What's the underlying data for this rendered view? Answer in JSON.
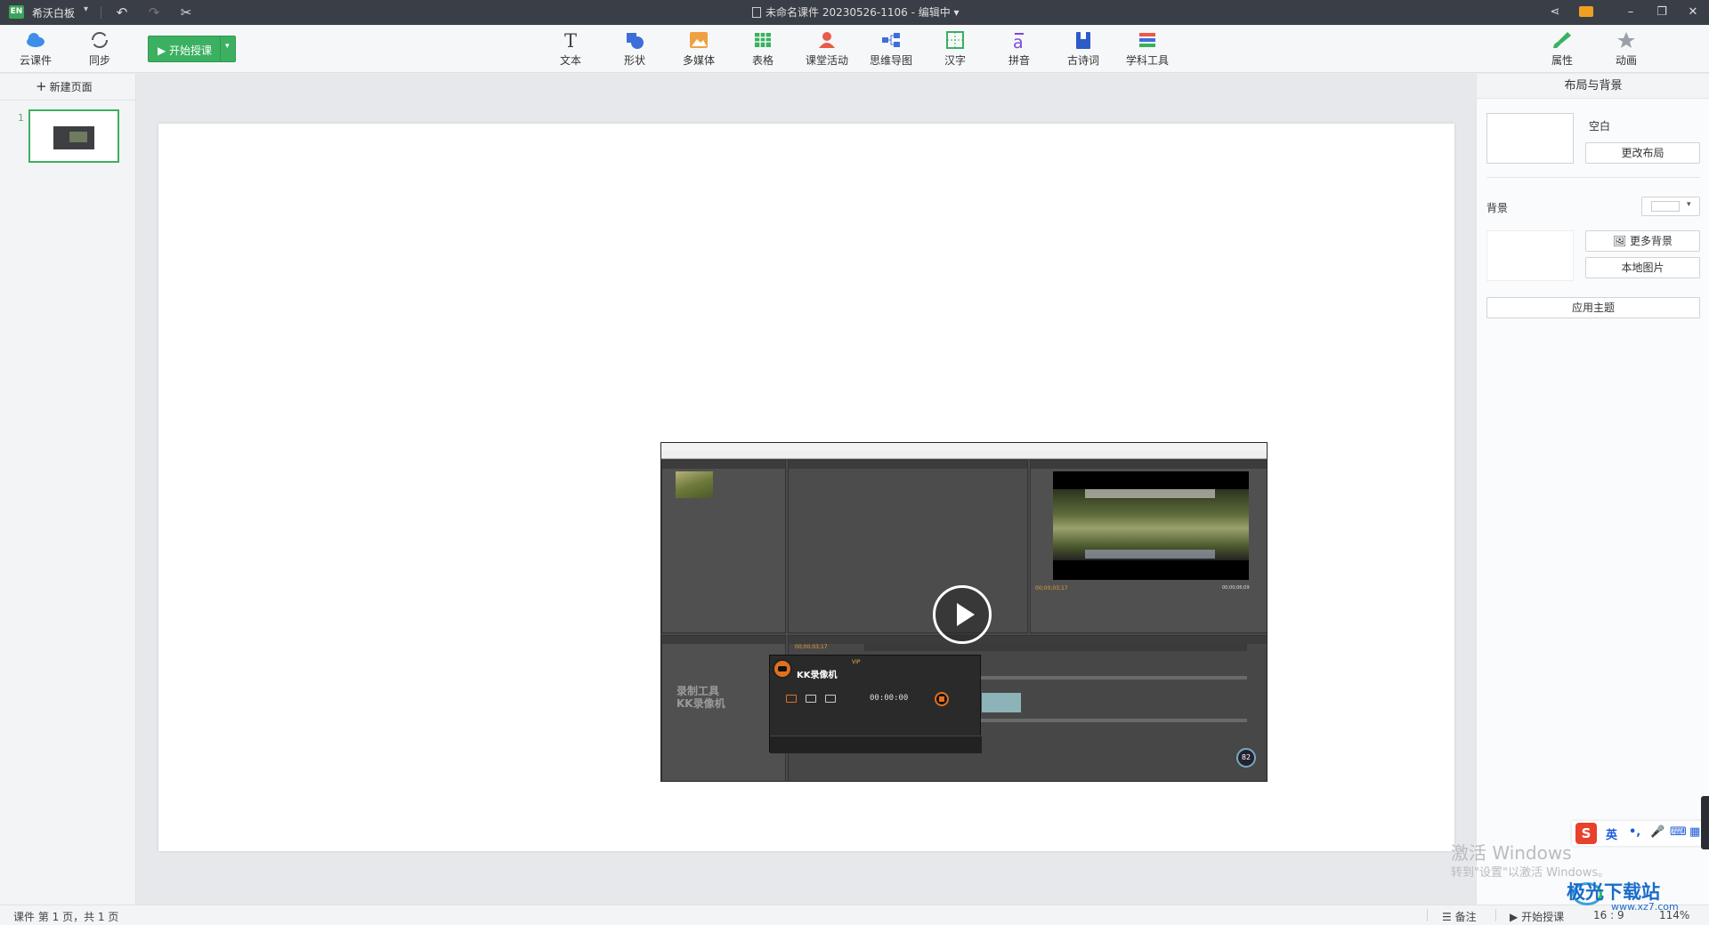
{
  "titlebar": {
    "logo": "EN",
    "app_name": "希沃白板",
    "doc_title": "未命名课件 20230526-1106 - 编辑中",
    "icons": [
      "undo-icon",
      "redo-icon",
      "scissors-icon",
      "share-icon",
      "mail-icon",
      "minimize-icon",
      "restore-icon",
      "close-icon"
    ]
  },
  "toolbar": {
    "cloud_label": "云课件",
    "sync_label": "同步",
    "start_label": "开始授课",
    "tools": [
      {
        "label": "文本",
        "icon": "text-icon"
      },
      {
        "label": "形状",
        "icon": "shape-icon"
      },
      {
        "label": "多媒体",
        "icon": "image-icon"
      },
      {
        "label": "表格",
        "icon": "table-icon"
      },
      {
        "label": "课堂活动",
        "icon": "activity-icon"
      },
      {
        "label": "思维导图",
        "icon": "mindmap-icon"
      },
      {
        "label": "汉字",
        "icon": "hanzi-icon"
      },
      {
        "label": "拼音",
        "icon": "pinyin-icon"
      },
      {
        "label": "古诗词",
        "icon": "poem-icon"
      },
      {
        "label": "学科工具",
        "icon": "subject-tools-icon"
      }
    ],
    "right_tabs": [
      {
        "label": "属性",
        "icon": "brush-icon"
      },
      {
        "label": "动画",
        "icon": "star-icon"
      }
    ]
  },
  "left_pane": {
    "new_page": "新建页面",
    "slides": [
      {
        "number": "1"
      }
    ]
  },
  "embedded_shot": {
    "recorder_title": "KK录像机",
    "recorder_time": "00:00:00",
    "recorder_vip": "VIP",
    "watermark_1": "录制工具",
    "watermark_2": "KK录像机",
    "timecode_1": "00;00;03;17",
    "timecode_2": "00;00;06;09",
    "cpu_value": "82"
  },
  "right_pane": {
    "title": "布局与背景",
    "layout_name": "空白",
    "change_layout": "更改布局",
    "background_label": "背景",
    "more_bg": "更多背景",
    "local_image": "本地图片",
    "apply_theme": "应用主题",
    "bg_color": "#ffffff"
  },
  "statusbar": {
    "info": "课件 第 1 页，共 1 页",
    "notes": "备注",
    "start": "开始授课",
    "ratio": "16 : 9",
    "zoom": "114%"
  },
  "overlays": {
    "activate_1": "激活 Windows",
    "activate_2": "转到\"设置\"以激活 Windows。",
    "brand": "极光下载站",
    "brand_url": "www.xz7.com",
    "ime_lang": "英"
  }
}
